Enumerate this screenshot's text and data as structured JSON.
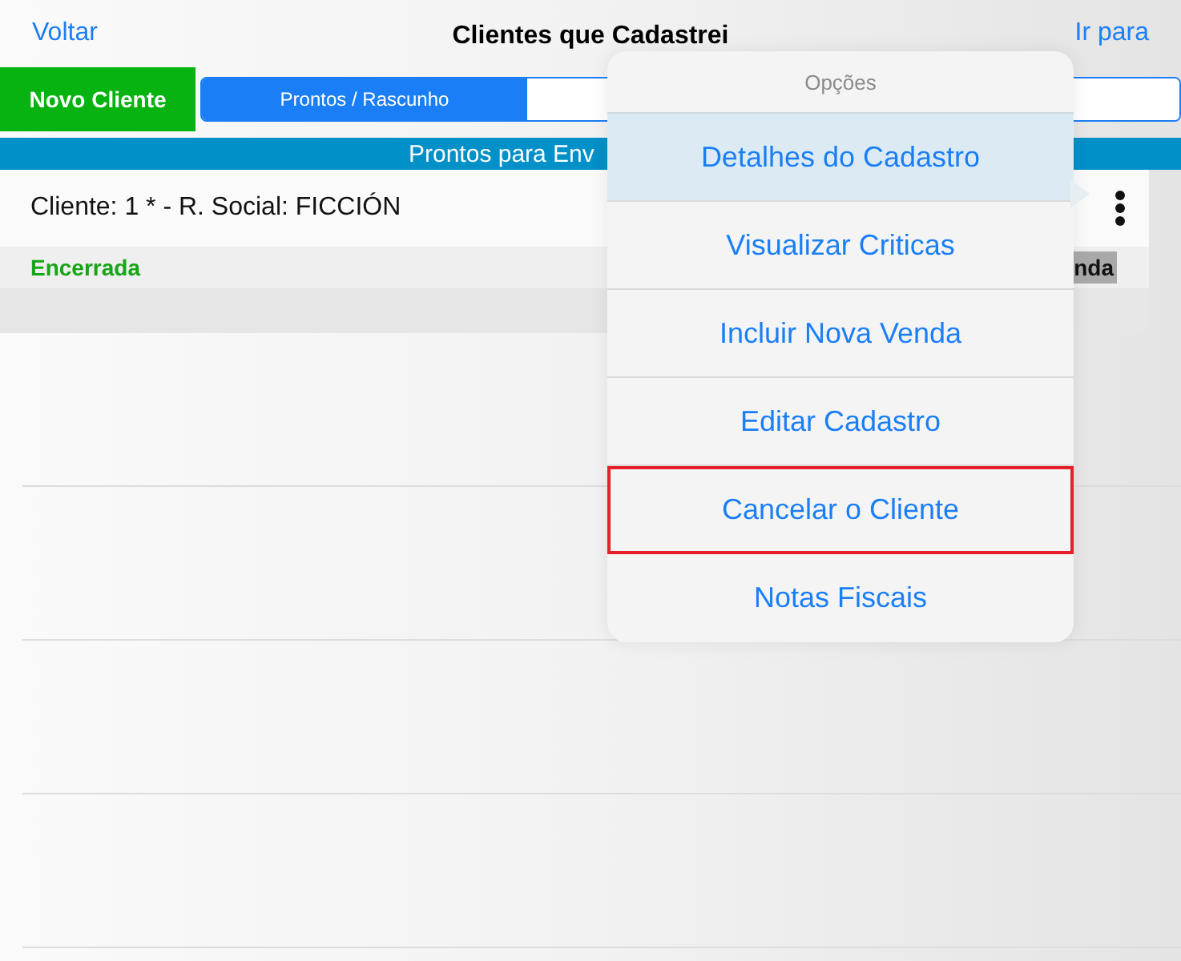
{
  "nav": {
    "back": "Voltar",
    "title": "Clientes que Cadastrei",
    "action": "Ir para"
  },
  "new_button": "Novo Cliente",
  "segments": [
    {
      "label": "Prontos / Rascunho",
      "selected": true
    },
    {
      "selected": false
    }
  ],
  "section_bar": "Prontos para Env",
  "client_row": {
    "title": "Cliente: 1 * - R. Social: FICCIÓN",
    "status": "Encerrada",
    "button": "nda"
  },
  "popover": {
    "title": "Opções",
    "items": [
      {
        "label": "Detalhes do Cadastro",
        "selected": true,
        "marked": false
      },
      {
        "label": "Visualizar Criticas",
        "selected": false,
        "marked": false
      },
      {
        "label": "Incluir Nova Venda",
        "selected": false,
        "marked": false
      },
      {
        "label": "Editar Cadastro",
        "selected": false,
        "marked": false
      },
      {
        "label": "Cancelar o Cliente",
        "selected": false,
        "marked": true
      },
      {
        "label": "Notas Fiscais",
        "selected": false,
        "marked": false
      }
    ]
  }
}
